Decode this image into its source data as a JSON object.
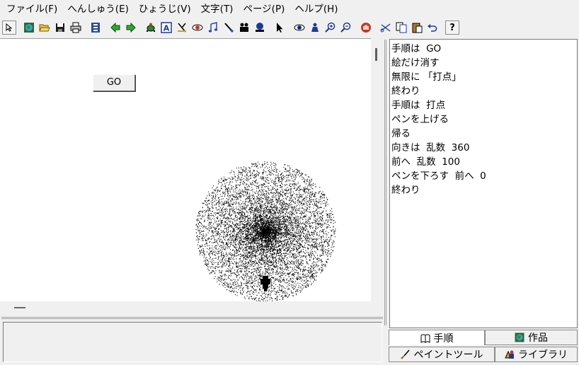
{
  "menu": [
    {
      "label": "ファイル(F)"
    },
    {
      "label": "へんしゅう(E)"
    },
    {
      "label": "ひょうじ(V)"
    },
    {
      "label": "文字(T)"
    },
    {
      "label": "ページ(P)"
    },
    {
      "label": "ヘルプ(H)"
    }
  ],
  "toolbar": {
    "icons": [
      "pointer-small-icon",
      "globe-icon",
      "open-folder-icon",
      "save-disk-icon",
      "print-icon",
      "book-icon",
      "arrow-left-icon",
      "arrow-right-icon",
      "turtle-icon",
      "text-a-icon",
      "text-cursor-icon",
      "eye-red-icon",
      "music-note-icon",
      "brush-icon",
      "camera-icon",
      "stamp-icon",
      "pointer-arrow-icon",
      "eye-icon",
      "person-icon",
      "zoom-in-icon",
      "zoom-out-icon",
      "stop-hand-icon",
      "scissors-icon",
      "copy-icon",
      "paste-icon",
      "undo-icon"
    ],
    "help_label": "?"
  },
  "canvas": {
    "go_button_label": "GO"
  },
  "code": {
    "lines": [
      "手順は  GO",
      "絵だけ消す",
      "無限に 「打点」",
      "終わり",
      "手順は  打点",
      "ペンを上げる",
      "帰る",
      "向きは  乱数  360",
      "前へ  乱数  100",
      "ペンを下ろす  前へ  0",
      "終わり"
    ]
  },
  "tabs": {
    "procedure": "手順",
    "works": "作品",
    "paint_tool": "ペイントツール",
    "library": "ライブラリ"
  }
}
